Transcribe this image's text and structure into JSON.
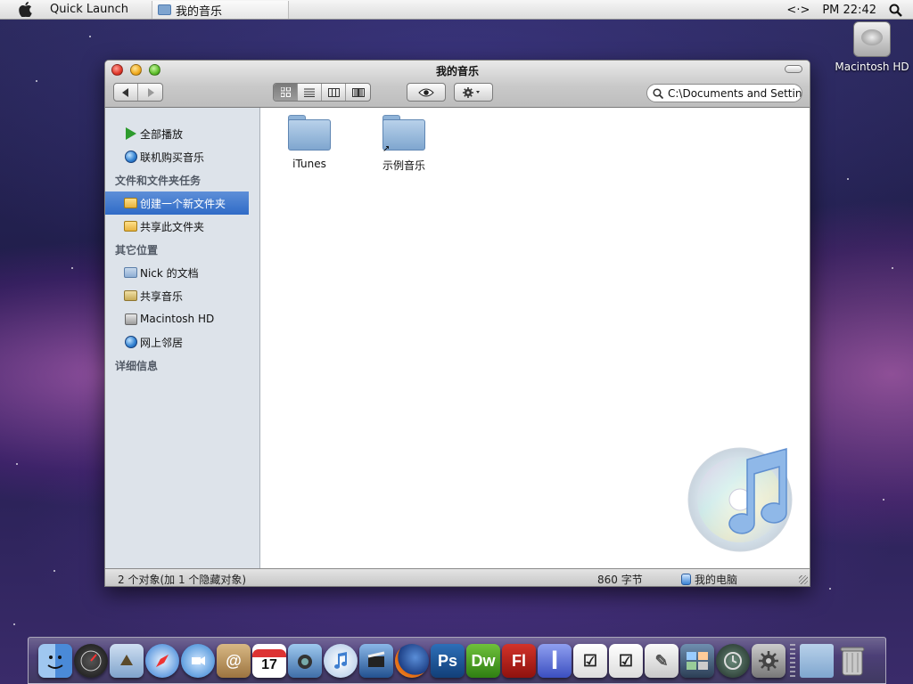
{
  "menubar": {
    "app_name": "Quick Launch",
    "active_window": "我的音乐",
    "nav_arrows": "<·>",
    "clock": "PM 22:42"
  },
  "desktop": {
    "hd_label": "Macintosh HD"
  },
  "window": {
    "title": "我的音乐",
    "search_value": "C:\\Documents and Settings\\Nick\\My Documents\\My Music",
    "sidebar": {
      "items_top": [
        {
          "label": "全部播放",
          "icon": "play-icon"
        },
        {
          "label": "联机购买音乐",
          "icon": "globe-icon"
        }
      ],
      "section1_title": "文件和文件夹任务",
      "section1_items": [
        {
          "label": "创建一个新文件夹",
          "icon": "new-folder-icon"
        },
        {
          "label": "共享此文件夹",
          "icon": "share-folder-icon"
        }
      ],
      "section2_title": "其它位置",
      "section2_items": [
        {
          "label": "Nick 的文档",
          "icon": "documents-folder-icon"
        },
        {
          "label": "共享音乐",
          "icon": "shared-music-folder-icon"
        },
        {
          "label": "Macintosh HD",
          "icon": "hard-drive-icon"
        },
        {
          "label": "网上邻居",
          "icon": "network-icon"
        }
      ],
      "section3_title": "详细信息"
    },
    "files": [
      {
        "name": "iTunes",
        "icon": "folder-icon"
      },
      {
        "name": "示例音乐",
        "icon": "folder-shortcut-icon"
      }
    ],
    "status": {
      "objects": "2 个对象(加 1 个隐藏对象)",
      "size": "860 字节",
      "location": "我的电脑"
    }
  },
  "dock": {
    "items": [
      "finder-icon",
      "dashboard-icon",
      "mail-icon",
      "safari-icon",
      "ichat-icon",
      "address-book-icon",
      "ical-icon",
      "iphoto-icon",
      "itunes-icon",
      "imovie-icon",
      "firefox-icon",
      "photoshop-icon",
      "dreamweaver-icon",
      "flash-icon",
      "textedit-icon",
      "todo-icon",
      "todo2-icon",
      "preview-icon",
      "spaces-icon",
      "time-machine-icon",
      "system-preferences-icon",
      "documents-stack-icon",
      "trash-icon"
    ],
    "labels": {
      "ps": "Ps",
      "dw": "Dw",
      "fl": "Fl",
      "ical_day": "17"
    }
  },
  "colors": {
    "selection": "#2f6bc7",
    "sidebar_bg": "#dde3ea",
    "folder_blue": "#8fb3d8"
  }
}
